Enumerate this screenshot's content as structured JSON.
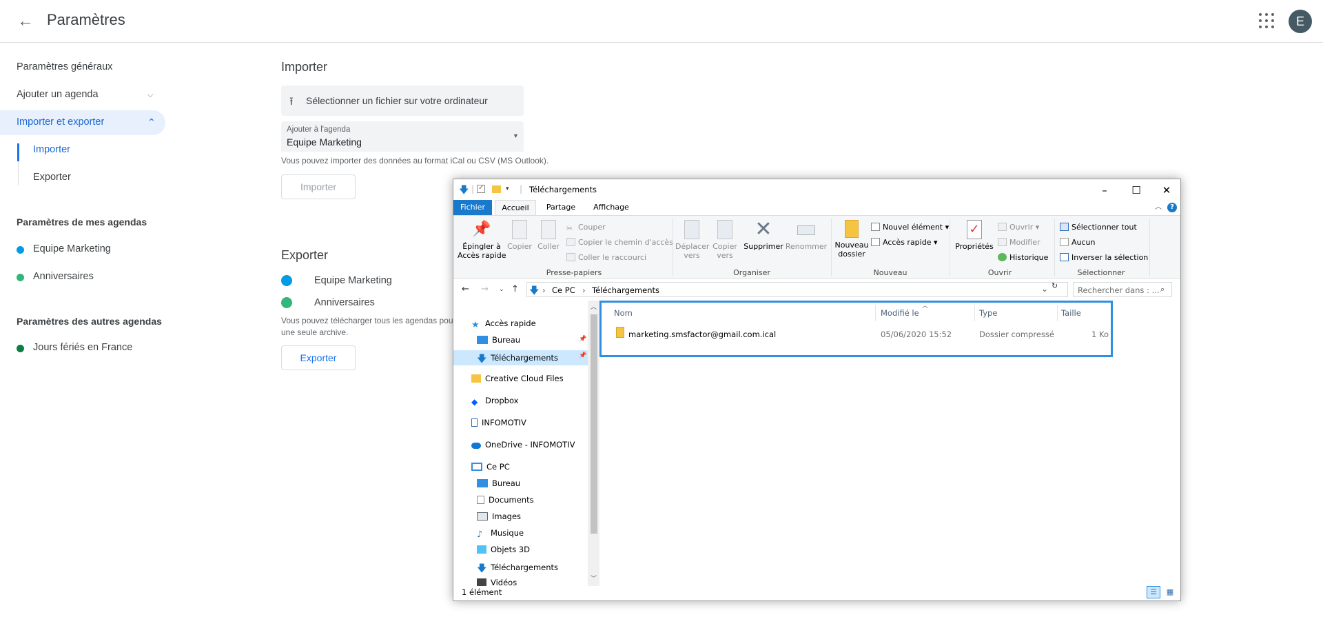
{
  "header": {
    "title": "Paramètres",
    "avatar_letter": "E"
  },
  "sidebar": {
    "items": [
      {
        "label": "Paramètres généraux"
      },
      {
        "label": "Ajouter un agenda"
      },
      {
        "label": "Importer et exporter"
      }
    ],
    "subitems": [
      {
        "label": "Importer"
      },
      {
        "label": "Exporter"
      }
    ],
    "my_calendars_heading": "Paramètres de mes agendas",
    "my_calendars": [
      {
        "label": "Equipe Marketing",
        "color": "#039be5"
      },
      {
        "label": "Anniversaires",
        "color": "#33b679"
      }
    ],
    "other_calendars_heading": "Paramètres des autres agendas",
    "other_calendars": [
      {
        "label": "Jours fériés en France",
        "color": "#0b8043"
      }
    ]
  },
  "import": {
    "heading": "Importer",
    "file_button": "Sélectionner un fichier sur votre ordinateur",
    "select_label": "Ajouter à l'agenda",
    "select_value": "Equipe Marketing",
    "hint": "Vous pouvez importer des données au format iCal ou CSV (MS Outlook).",
    "button": "Importer"
  },
  "export": {
    "heading": "Exporter",
    "calendars": [
      {
        "label": "Equipe Marketing",
        "color": "#039be5"
      },
      {
        "label": "Anniversaires",
        "color": "#33b679"
      }
    ],
    "hint_line1": "Vous pouvez télécharger tous les agendas pou",
    "hint_line2": "une seule archive.",
    "button": "Exporter"
  },
  "explorer": {
    "title": "Téléchargements",
    "tabs": [
      "Fichier",
      "Accueil",
      "Partage",
      "Affichage"
    ],
    "ribbon": {
      "pin": "Épingler à\nAccès rapide",
      "copy": "Copier",
      "paste": "Coller",
      "cut": "Couper",
      "copy_path": "Copier le chemin d'accès",
      "paste_shortcut": "Coller le raccourci",
      "group_clipboard": "Presse-papiers",
      "move_to": "Déplacer\nvers",
      "copy_to": "Copier\nvers",
      "delete": "Supprimer",
      "rename": "Renommer",
      "group_organize": "Organiser",
      "new_folder": "Nouveau\ndossier",
      "new_item": "Nouvel élément",
      "easy_access": "Accès rapide",
      "group_new": "Nouveau",
      "properties": "Propriétés",
      "open": "Ouvrir",
      "edit": "Modifier",
      "history": "Historique",
      "group_open": "Ouvrir",
      "select_all": "Sélectionner tout",
      "select_none": "Aucun",
      "invert_selection": "Inverser la sélection",
      "group_select": "Sélectionner"
    },
    "breadcrumb": [
      "Ce PC",
      "Téléchargements"
    ],
    "search_placeholder": "Rechercher dans : ...",
    "nav": {
      "quick_access": "Accès rapide",
      "qa_bureau": "Bureau",
      "qa_downloads": "Téléchargements",
      "creative_cloud": "Creative Cloud Files",
      "dropbox": "Dropbox",
      "infomotiv": "INFOMOTIV",
      "onedrive": "OneDrive - INFOMOTIV",
      "this_pc": "Ce PC",
      "pc_bureau": "Bureau",
      "pc_documents": "Documents",
      "pc_images": "Images",
      "pc_music": "Musique",
      "pc_3d": "Objets 3D",
      "pc_downloads": "Téléchargements",
      "pc_videos": "Vidéos"
    },
    "columns": [
      "Nom",
      "Modifié le",
      "Type",
      "Taille"
    ],
    "files": [
      {
        "name": "marketing.smsfactor@gmail.com.ical",
        "modified": "05/06/2020 15:52",
        "type": "Dossier compressé",
        "size": "1 Ko"
      }
    ],
    "status": "1 élément"
  }
}
